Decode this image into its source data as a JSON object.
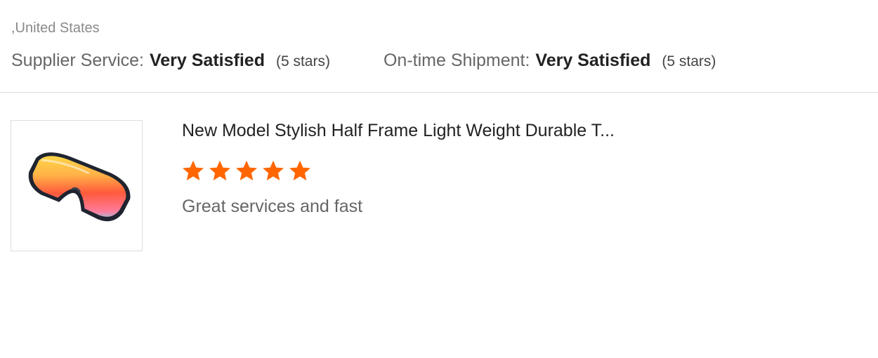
{
  "reviewer": {
    "location": ",United States"
  },
  "ratings": [
    {
      "label": "Supplier Service:",
      "value": "Very Satisfied",
      "stars_text": "(5 stars)"
    },
    {
      "label": "On-time Shipment:",
      "value": "Very Satisfied",
      "stars_text": "(5 stars)"
    }
  ],
  "review": {
    "product_title": "New Model Stylish Half Frame Light Weight Durable T...",
    "star_rating": 5,
    "star_max": 5,
    "star_color": "#ff6600",
    "comment": "Great services and fast",
    "thumbnail_icon": "sunglasses-image"
  }
}
